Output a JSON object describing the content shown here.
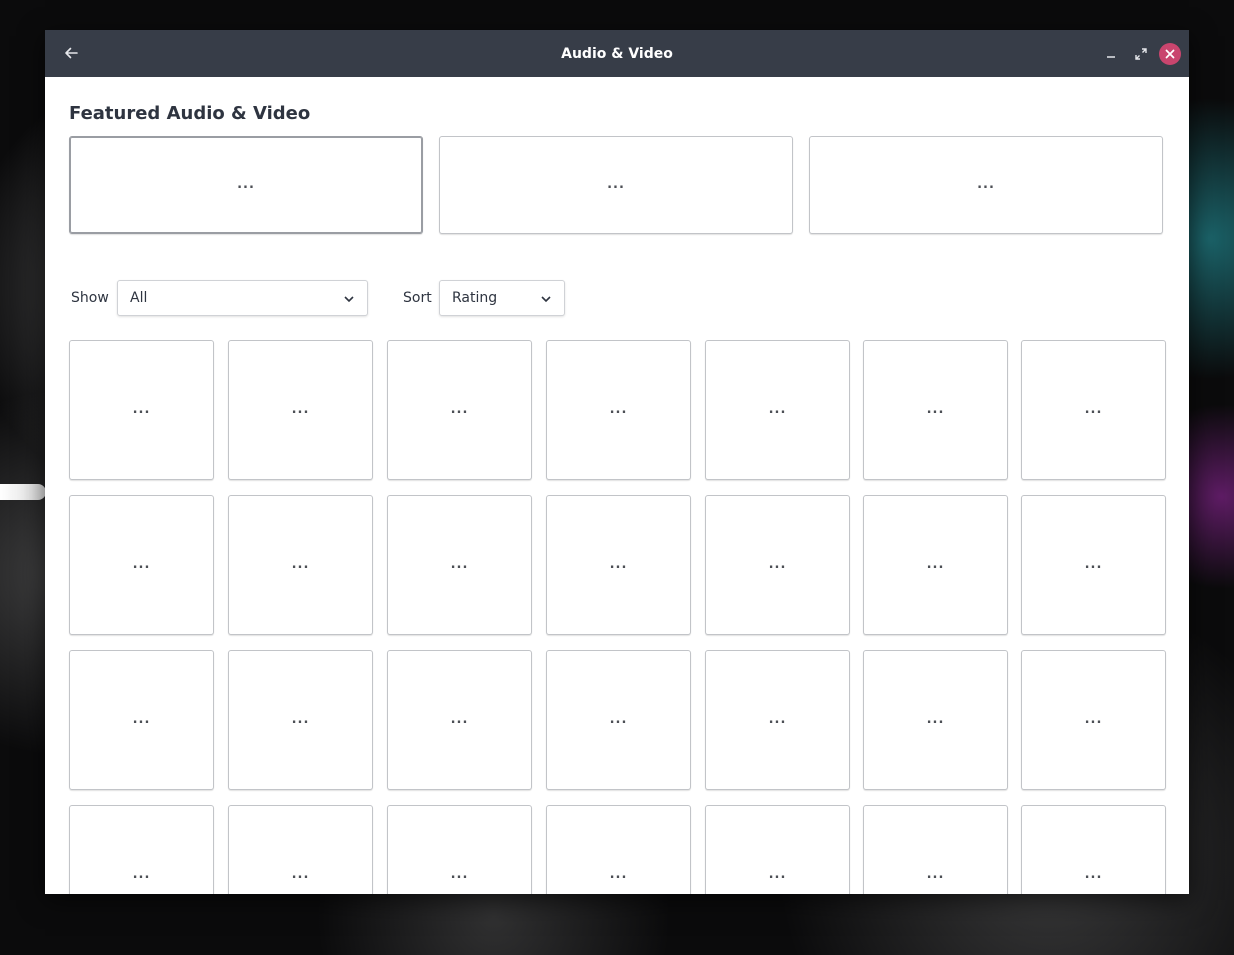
{
  "window": {
    "title": "Audio & Video",
    "back_icon": "back-arrow-icon",
    "minimize_icon": "minimize-icon",
    "maximize_icon": "maximize-icon",
    "close_icon": "close-icon",
    "close_color": "#c9456e",
    "titlebar_color": "#373d48"
  },
  "featured": {
    "heading": "Featured Audio & Video",
    "cards": [
      {
        "label": "..."
      },
      {
        "label": "..."
      },
      {
        "label": "..."
      }
    ]
  },
  "filters": {
    "show_label": "Show",
    "show_value": "All",
    "sort_label": "Sort",
    "sort_value": "Rating"
  },
  "apps": {
    "placeholder": "...",
    "count": 28
  }
}
